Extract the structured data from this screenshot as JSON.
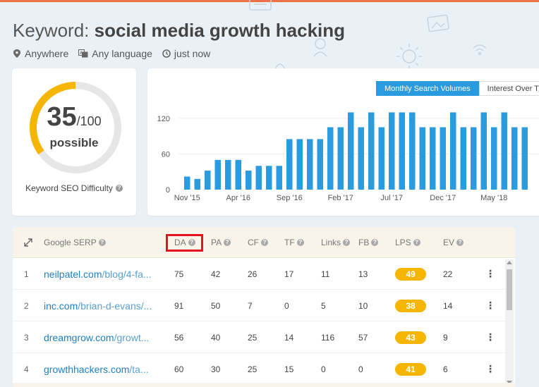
{
  "colors": {
    "accent_blue": "#2a9bde",
    "gauge_yellow": "#f6b500",
    "gauge_track": "#e6e6e6",
    "highlight_red": "#e8101e",
    "link_blue": "#1e7fc4"
  },
  "header": {
    "title_prefix": "Keyword:",
    "keyword": "social media growth hacking",
    "location": "Anywhere",
    "language": "Any language",
    "time": "just now",
    "location_icon": "location-pin-icon",
    "language_icon": "translate-icon",
    "time_icon": "clock-icon"
  },
  "difficulty": {
    "score": "35",
    "max": "/100",
    "fraction": 0.35,
    "label": "possible",
    "title": "Keyword SEO Difficulty"
  },
  "volume": {
    "tab_active": "Monthly Search Volumes",
    "tab_inactive": "Interest Over Ti"
  },
  "chart_data": {
    "type": "bar",
    "yticks": [
      0,
      60,
      120
    ],
    "xtick_labels": [
      "Nov '15",
      "Apr '16",
      "Sep '16",
      "Feb '17",
      "Jul '17",
      "Dec '17",
      "May '18"
    ],
    "xtick_index": [
      0,
      5,
      10,
      15,
      20,
      25,
      30
    ],
    "values": [
      22,
      18,
      32,
      50,
      50,
      50,
      32,
      40,
      40,
      40,
      85,
      85,
      85,
      85,
      105,
      105,
      130,
      105,
      130,
      105,
      130,
      130,
      130,
      105,
      105,
      105,
      130,
      105,
      105,
      130,
      105,
      130,
      105,
      105
    ],
    "ylim": [
      0,
      140
    ],
    "grid": true,
    "bar_color": "#2a9bde"
  },
  "serp": {
    "headers": {
      "serp": "Google SERP",
      "da": "DA",
      "pa": "PA",
      "cf": "CF",
      "tf": "TF",
      "links": "Links",
      "fb": "FB",
      "lps": "LPS",
      "ev": "EV"
    },
    "rows": [
      {
        "rank": "1",
        "domain": "neilpatel.com",
        "path": "/blog/4-fa...",
        "da": "75",
        "pa": "42",
        "cf": "26",
        "tf": "17",
        "links": "11",
        "fb": "13",
        "lps": "49",
        "ev": "22"
      },
      {
        "rank": "2",
        "domain": "inc.com",
        "path": "/brian-d-evans/...",
        "da": "91",
        "pa": "50",
        "cf": "7",
        "tf": "0",
        "links": "5",
        "fb": "10",
        "lps": "38",
        "ev": "14"
      },
      {
        "rank": "3",
        "domain": "dreamgrow.com",
        "path": "/growt...",
        "da": "56",
        "pa": "40",
        "cf": "25",
        "tf": "14",
        "links": "116",
        "fb": "57",
        "lps": "43",
        "ev": "9"
      },
      {
        "rank": "4",
        "domain": "growthhackers.com",
        "path": "/ta...",
        "da": "60",
        "pa": "30",
        "cf": "25",
        "tf": "15",
        "links": "0",
        "fb": "0",
        "lps": "41",
        "ev": "6"
      }
    ]
  }
}
